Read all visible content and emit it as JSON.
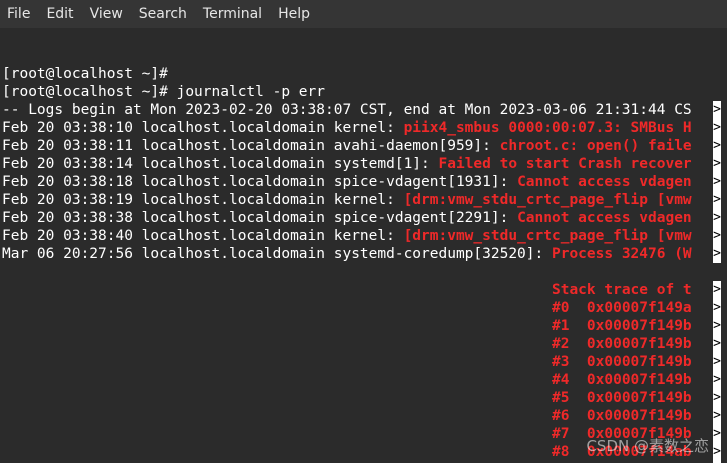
{
  "menu": [
    "File",
    "Edit",
    "View",
    "Search",
    "Terminal",
    "Help"
  ],
  "terminal": {
    "lines": [
      {
        "plain": "",
        "err": ""
      },
      {
        "plain": "[root@localhost ~]#",
        "err": ""
      },
      {
        "plain": "[root@localhost ~]# journalctl -p err",
        "err": ""
      },
      {
        "plain": "-- Logs begin at Mon 2023-02-20 03:38:07 CST, end at Mon 2023-03-06 21:31:44 CS",
        "err": ""
      },
      {
        "plain": "Feb 20 03:38:10 localhost.localdomain kernel: ",
        "err": "piix4_smbus 0000:00:07.3: SMBus H"
      },
      {
        "plain": "Feb 20 03:38:11 localhost.localdomain avahi-daemon[959]: ",
        "err": "chroot.c: open() faile"
      },
      {
        "plain": "Feb 20 03:38:14 localhost.localdomain systemd[1]: ",
        "err": "Failed to start Crash recover"
      },
      {
        "plain": "Feb 20 03:38:18 localhost.localdomain spice-vdagent[1931]: ",
        "err": "Cannot access vdagen"
      },
      {
        "plain": "Feb 20 03:38:19 localhost.localdomain kernel: ",
        "err": "[drm:vmw_stdu_crtc_page_flip [vmw"
      },
      {
        "plain": "Feb 20 03:38:38 localhost.localdomain spice-vdagent[2291]: ",
        "err": "Cannot access vdagen"
      },
      {
        "plain": "Feb 20 03:38:40 localhost.localdomain kernel: ",
        "err": "[drm:vmw_stdu_crtc_page_flip [vmw"
      },
      {
        "plain": "Mar 06 20:27:56 localhost.localdomain systemd-coredump[32520]: ",
        "err": "Process 32476 (W"
      },
      {
        "plain": "",
        "err": ""
      },
      {
        "plain": "                                                               ",
        "err": "Stack trace of t"
      },
      {
        "plain": "                                                               ",
        "err": "#0  0x00007f149a"
      },
      {
        "plain": "                                                               ",
        "err": "#1  0x00007f149b"
      },
      {
        "plain": "                                                               ",
        "err": "#2  0x00007f149b"
      },
      {
        "plain": "                                                               ",
        "err": "#3  0x00007f149b"
      },
      {
        "plain": "                                                               ",
        "err": "#4  0x00007f149b"
      },
      {
        "plain": "                                                               ",
        "err": "#5  0x00007f149b"
      },
      {
        "plain": "                                                               ",
        "err": "#6  0x00007f149b"
      },
      {
        "plain": "                                                               ",
        "err": "#7  0x00007f149b"
      },
      {
        "plain": "                                                               ",
        "err": "#8  0x00007f14ab"
      },
      {
        "plain": "                                                               ",
        "err": "#9  0x00007f14ab"
      }
    ],
    "truncated_rows": [
      3,
      4,
      5,
      6,
      7,
      8,
      9,
      10,
      11,
      13,
      14,
      15,
      16,
      17,
      18,
      19,
      20,
      21,
      22,
      23
    ],
    "truncation_marker": ">"
  },
  "watermark": "CSDN @素数之恋",
  "colors": {
    "error_text": "#ef2929",
    "terminal_bg": "#2b2b2b",
    "menubar_bg": "#353535"
  }
}
